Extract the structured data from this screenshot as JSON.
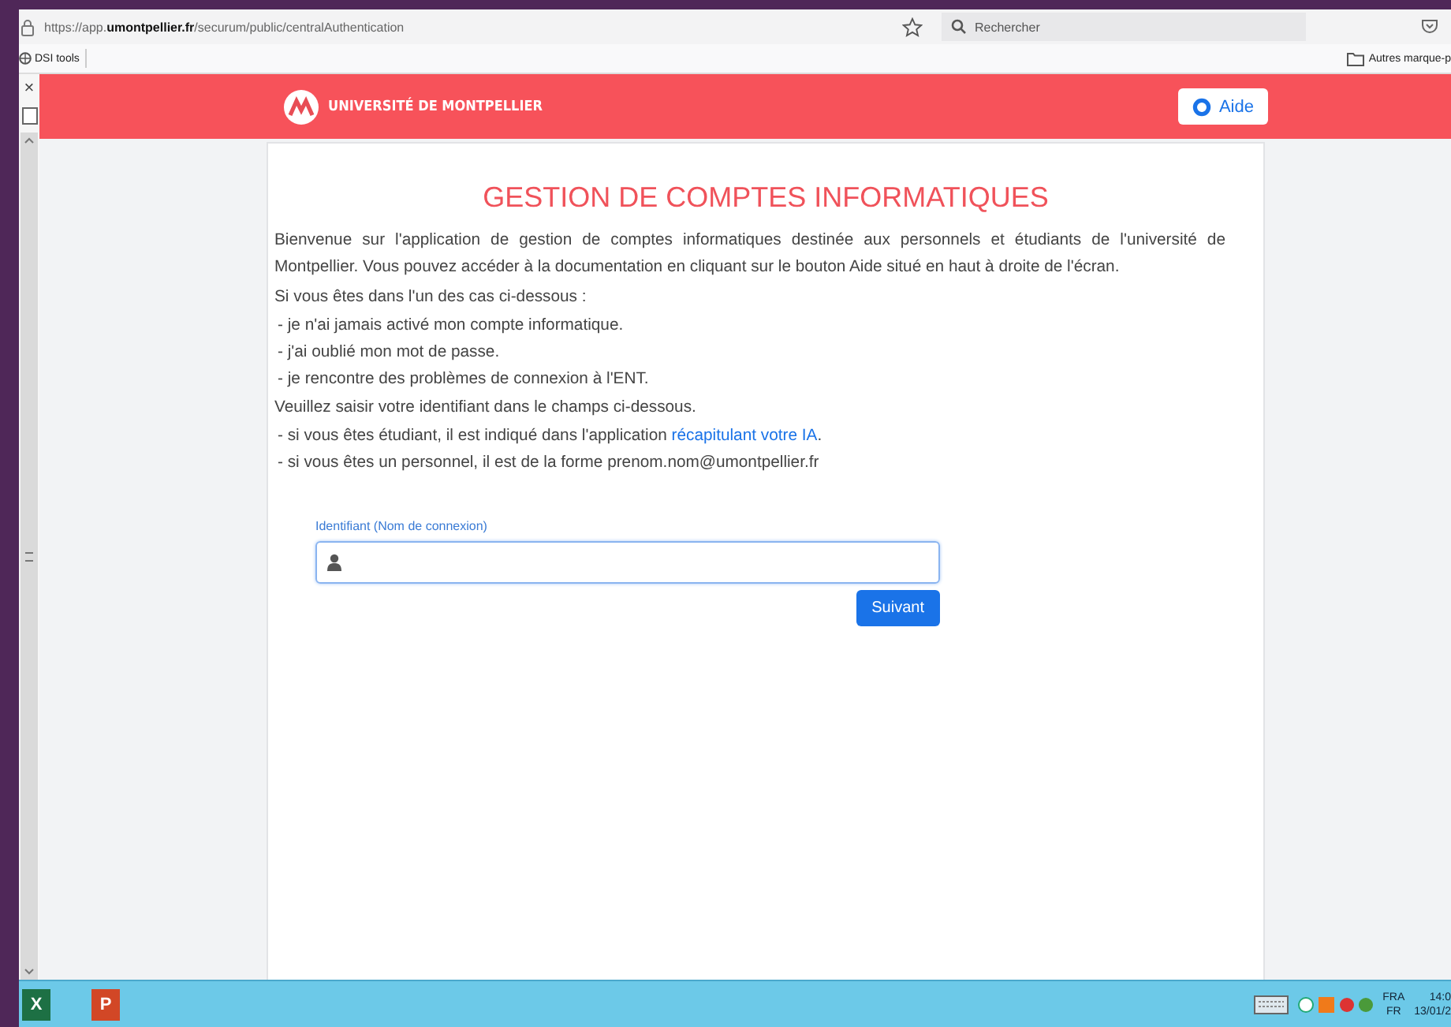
{
  "browser": {
    "url": "https://app.**umontpellier.fr**/securum/public/centralAuthentication",
    "search_placeholder": "Rechercher",
    "bookmarks": [
      "DSI tools"
    ],
    "other_bookmarks": "Autres marque-p",
    "sidebar_close": "×"
  },
  "header": {
    "logo_text": "UNIVERSITÉ DE MONTPELLIER",
    "help_button": "Aide"
  },
  "page": {
    "title": "GESTION DE COMPTES INFORMATIQUES",
    "intro": "Bienvenue sur l'application de gestion de comptes informatiques destinée aux personnels et étudiants de l'université de Montpellier. Vous pouvez accéder à la documentation en cliquant sur le bouton Aide situé en haut à droite de l'écran.",
    "cases_intro": "Si vous êtes dans l'un des cas ci-dessous :",
    "cases": [
      "- je n'ai jamais activé mon compte informatique.",
      "- j'ai oublié mon mot de passe.",
      "- je rencontre des problèmes de connexion à l'ENT."
    ],
    "id_intro": "Veuillez saisir votre identifiant dans le champs ci-dessous.",
    "id_hints": [
      {
        "text": "- si vous êtes étudiant, il est indiqué dans l'application ",
        "link": "récapitulant votre IA",
        "after": "."
      },
      {
        "text": "- si vous êtes un personnel, il est de la forme prenom.nom@umontpellier.fr"
      }
    ],
    "field_label": "Identifiant (Nom de connexion)",
    "submit": "Suivant"
  },
  "taskbar": {
    "apps": [
      {
        "kind": "excel",
        "letter": "X"
      },
      {
        "kind": "powerpoint",
        "letter": "P"
      }
    ],
    "language": "FRA",
    "layout": "FR",
    "time": "14:0",
    "date": "13/01/2"
  }
}
